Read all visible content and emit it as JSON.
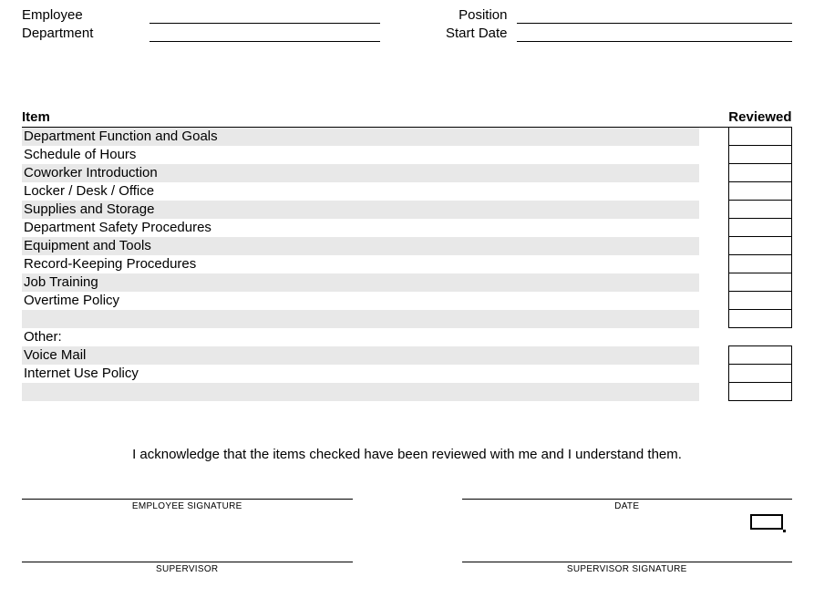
{
  "header": {
    "employee_label": "Employee",
    "department_label": "Department",
    "position_label": "Position",
    "start_date_label": "Start Date"
  },
  "table": {
    "header_item": "Item",
    "header_reviewed": "Reviewed",
    "rows": [
      "Department Function and Goals",
      "Schedule of Hours",
      "Coworker Introduction",
      "Locker / Desk / Office",
      "Supplies and Storage",
      "Department Safety Procedures",
      "Equipment and Tools",
      "Record-Keeping Procedures",
      "Job Training",
      "Overtime Policy"
    ],
    "other_label": "Other:",
    "other_rows": [
      "Voice Mail",
      "Internet Use Policy"
    ]
  },
  "ack_text": "I acknowledge that the items checked have been reviewed with me and I understand them.",
  "sig": {
    "employee": "EMPLOYEE SIGNATURE",
    "date": "DATE",
    "supervisor": "SUPERVISOR",
    "supervisor_sig": "SUPERVISOR SIGNATURE"
  }
}
